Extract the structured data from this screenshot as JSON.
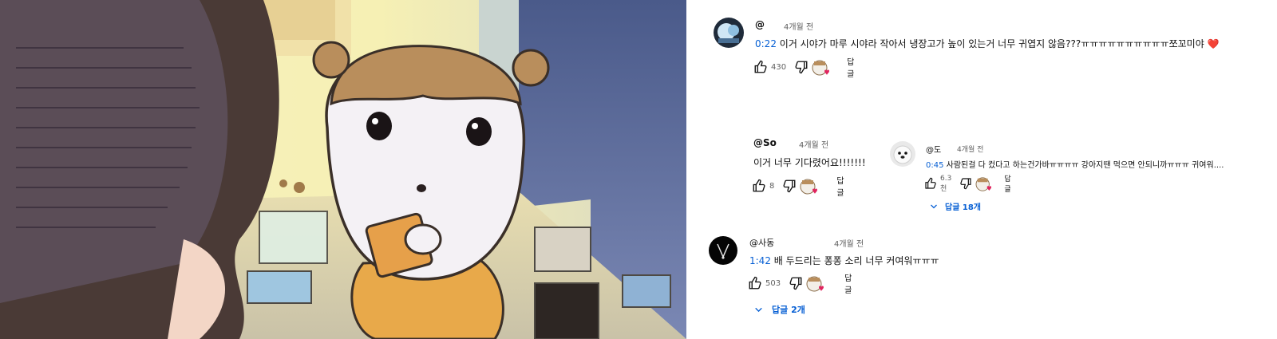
{
  "video": {
    "description": "cartoon frame"
  },
  "comments": [
    {
      "handle": "@",
      "time": "4개월 전",
      "timestamp": "0:22",
      "text": "이거 시야가 마루 시야라 작아서 냉장고가 높이 있는거 너무 귀엽지 않음???ㅠㅠㅠㅠㅠㅠㅠㅠㅠㅠ쪼꼬미야",
      "heart_emoji": "❤️",
      "likes": "430",
      "reply_label": "답글"
    },
    {
      "handle": "@So",
      "time": "4개월 전",
      "timestamp": "",
      "text": "이거 너무 기다렸어요!!!!!!!",
      "likes": "8",
      "reply_label": "답글"
    },
    {
      "handle": "@도",
      "time": "4개월 전",
      "timestamp": "0:45",
      "text": "사람된걸 다 컸다고 하는건가바ㅠㅠㅠㅠ 강아지땐 먹으면 안되니까ㅠㅠㅠ 귀여워....",
      "likes": "6.3천",
      "reply_label": "답글",
      "replies_label": "답글 18개"
    },
    {
      "handle": "@사동",
      "time": "4개월 전",
      "timestamp": "1:42",
      "text": "배 두드리는 퐁퐁 소리 너무 커여워ㅠㅠㅠ",
      "likes": "503",
      "reply_label": "답글",
      "replies_label": "답글 2개"
    }
  ],
  "colors": {
    "link": "#065fd4",
    "meta": "#606060",
    "heart": "#e0245e"
  }
}
